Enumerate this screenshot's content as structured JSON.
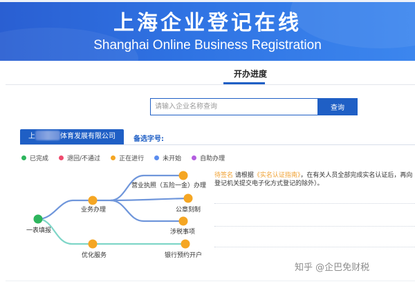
{
  "banner": {
    "title_cn": "上海企业登记在线",
    "title_en": "Shanghai Online Business Registration"
  },
  "tab": {
    "label": "开办进度"
  },
  "search": {
    "placeholder": "请输入企业名称查询",
    "value": "",
    "button_label": "查询"
  },
  "company": {
    "name_prefix": "上",
    "name_suffix": "体育发展有限公司",
    "alt_name_label": "备选字号:"
  },
  "legend": [
    {
      "label": "已完成",
      "color": "#2db55d"
    },
    {
      "label": "退回/不通过",
      "color": "#ef4b6e"
    },
    {
      "label": "正在进行",
      "color": "#f5a623"
    },
    {
      "label": "未开始",
      "color": "#5b8def"
    },
    {
      "label": "自助办理",
      "color": "#b45ee0"
    }
  ],
  "flow": {
    "colors": {
      "done": "#2db55d",
      "in_progress": "#f5a623",
      "line_blue": "#6f96db",
      "line_teal": "#7fd6c8"
    },
    "nodes": {
      "start": "一表填报",
      "business": "业务办理",
      "license": "营业执照（五险一金）办理",
      "seal": "公章刻制",
      "tax": "涉税事项",
      "optimize": "优化服务",
      "bank": "银行预约开户"
    }
  },
  "detail": {
    "status": "待签名",
    "text_before": " 请根据",
    "guide": "《实名认证指南》",
    "text_after": "，在有关人员全部完成实名认证后，再向登记机关提交电子化方式登记的除外）。"
  },
  "watermark": "知乎 @企巴免财税"
}
